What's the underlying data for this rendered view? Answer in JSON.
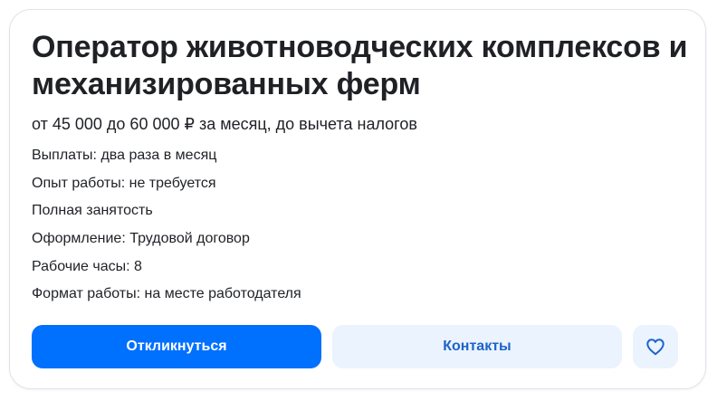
{
  "vacancy": {
    "title": "Оператор животноводческих комплексов и механизированных ферм",
    "salary": "от 45 000 до 60 000 ₽ за месяц, до вычета налогов",
    "details": [
      "Выплаты: два раза в месяц",
      "Опыт работы: не требуется",
      "Полная занятость",
      "Оформление: Трудовой договор",
      "Рабочие часы: 8",
      "Формат работы: на месте работодателя"
    ]
  },
  "actions": {
    "respond_label": "Откликнуться",
    "contacts_label": "Контакты",
    "favorite_icon": "heart-icon"
  },
  "colors": {
    "primary": "#0070ff",
    "secondary_bg": "#eaf3fe",
    "secondary_text": "#1d63c9",
    "text": "#1f2126"
  }
}
